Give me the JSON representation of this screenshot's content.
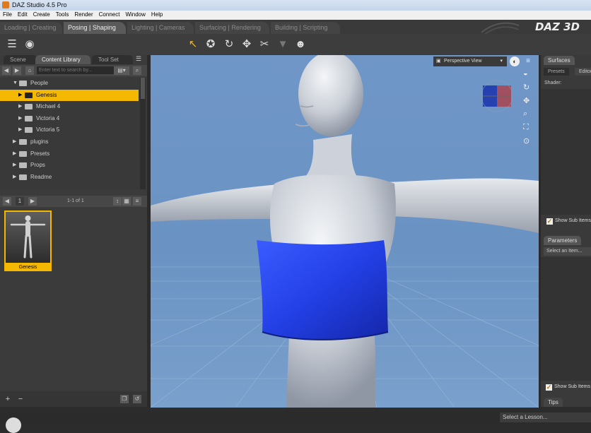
{
  "window": {
    "title": "DAZ Studio 4.5 Pro"
  },
  "menu": [
    "File",
    "Edit",
    "Create",
    "Tools",
    "Render",
    "Connect",
    "Window",
    "Help"
  ],
  "activity_tabs": [
    {
      "label": "Loading | Creating"
    },
    {
      "label": "Posing | Shaping"
    },
    {
      "label": "Lighting | Cameras"
    },
    {
      "label": "Surfacing | Rendering"
    },
    {
      "label": "Building | Scripting"
    }
  ],
  "logo": "DAZ 3D",
  "left_panel": {
    "tabs": [
      "Scene",
      "Content Library",
      "Tool Set"
    ],
    "search_placeholder": "Enter text to search by...",
    "tree": [
      {
        "label": "People",
        "level": 1,
        "expanded": true,
        "selected": false
      },
      {
        "label": "Genesis",
        "level": 2,
        "expanded": false,
        "selected": true
      },
      {
        "label": "Michael 4",
        "level": 2,
        "expanded": false,
        "selected": false
      },
      {
        "label": "Victoria 4",
        "level": 2,
        "expanded": false,
        "selected": false
      },
      {
        "label": "Victoria 5",
        "level": 2,
        "expanded": false,
        "selected": false
      },
      {
        "label": "plugins",
        "level": 1,
        "expanded": false,
        "selected": false
      },
      {
        "label": "Presets",
        "level": 1,
        "expanded": false,
        "selected": false
      },
      {
        "label": "Props",
        "level": 1,
        "expanded": false,
        "selected": false
      },
      {
        "label": "Readme",
        "level": 1,
        "expanded": false,
        "selected": false
      }
    ],
    "page_number": "1",
    "page_info": "1-1 of 1",
    "thumbnail_label": "Genesis"
  },
  "viewport": {
    "view_label": "Perspective View"
  },
  "right_panel": {
    "surfaces_tab": "Surfaces",
    "presets_tab": "Presets",
    "editor_tab": "Editor",
    "shader_label": "Shader:",
    "show_sub_items_1": "Show Sub Items",
    "parameters_tab": "Parameters",
    "select_item": "Select an Item...",
    "show_sub_items_2": "Show Sub Items",
    "tips_tab": "Tips"
  },
  "status": {
    "lesson_select": "Select a Lesson..."
  },
  "colors": {
    "accent": "#f5b800",
    "viewport": "#6f96c7",
    "garment": "#1f3fe0"
  }
}
